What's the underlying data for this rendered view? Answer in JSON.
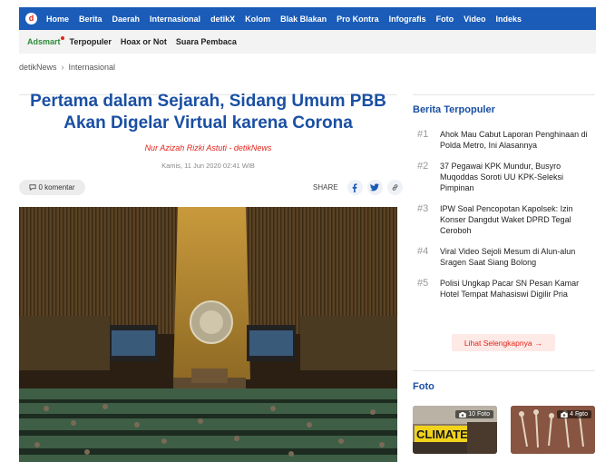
{
  "brand": {
    "logo_letter": "d"
  },
  "topnav": {
    "items": [
      "Home",
      "Berita",
      "Daerah",
      "Internasional",
      "detikX",
      "Kolom",
      "Blak Blakan",
      "Pro Kontra",
      "Infografis",
      "Foto",
      "Video",
      "Indeks"
    ]
  },
  "subnav": {
    "items": [
      "Adsmart",
      "Terpopuler",
      "Hoax or Not",
      "Suara Pembaca"
    ]
  },
  "breadcrumb": {
    "items": [
      "detikNews",
      "Internasional"
    ],
    "separator": "›"
  },
  "article": {
    "title": "Pertama dalam Sejarah, Sidang Umum PBB Akan Digelar Virtual karena Corona",
    "author": "Nur Azizah Rizki Astuti - detikNews",
    "date": "Kamis, 11 Jun 2020 02:41 WIB",
    "comments": "0 komentar",
    "share_label": "SHARE"
  },
  "sidebar": {
    "popular_title": "Berita Terpopuler",
    "popular": [
      {
        "num": "#1",
        "text": "Ahok Mau Cabut Laporan Penghinaan di Polda Metro, Ini Alasannya"
      },
      {
        "num": "#2",
        "text": "37 Pegawai KPK Mundur, Busyro Muqoddas Soroti UU KPK-Seleksi Pimpinan"
      },
      {
        "num": "#3",
        "text": "IPW Soal Pencopotan Kapolsek: Izin Konser Dangdut Waket DPRD Tegal Ceroboh"
      },
      {
        "num": "#4",
        "text": "Viral Video Sejoli Mesum di Alun-alun Sragen Saat Siang Bolong"
      },
      {
        "num": "#5",
        "text": "Polisi Ungkap Pacar SN Pesan Kamar Hotel Tempat Mahasiswi Digilir Pria"
      }
    ],
    "more_label": "Lihat Selengkapnya",
    "more_arrow": "→",
    "foto_title": "Foto",
    "foto_cards": [
      {
        "badge": "10 Foto",
        "sign_text": "CLIMATE"
      },
      {
        "badge": "4 Foto"
      }
    ]
  },
  "colors": {
    "nav_blue": "#1a5cb8",
    "title_blue": "#1a4fa3",
    "accent_red": "#e2231a",
    "adsmart_green": "#2e8b3a"
  },
  "icons": {
    "comment": "comment-icon",
    "facebook": "facebook-icon",
    "twitter": "twitter-icon",
    "link": "link-icon",
    "camera": "camera-icon"
  }
}
